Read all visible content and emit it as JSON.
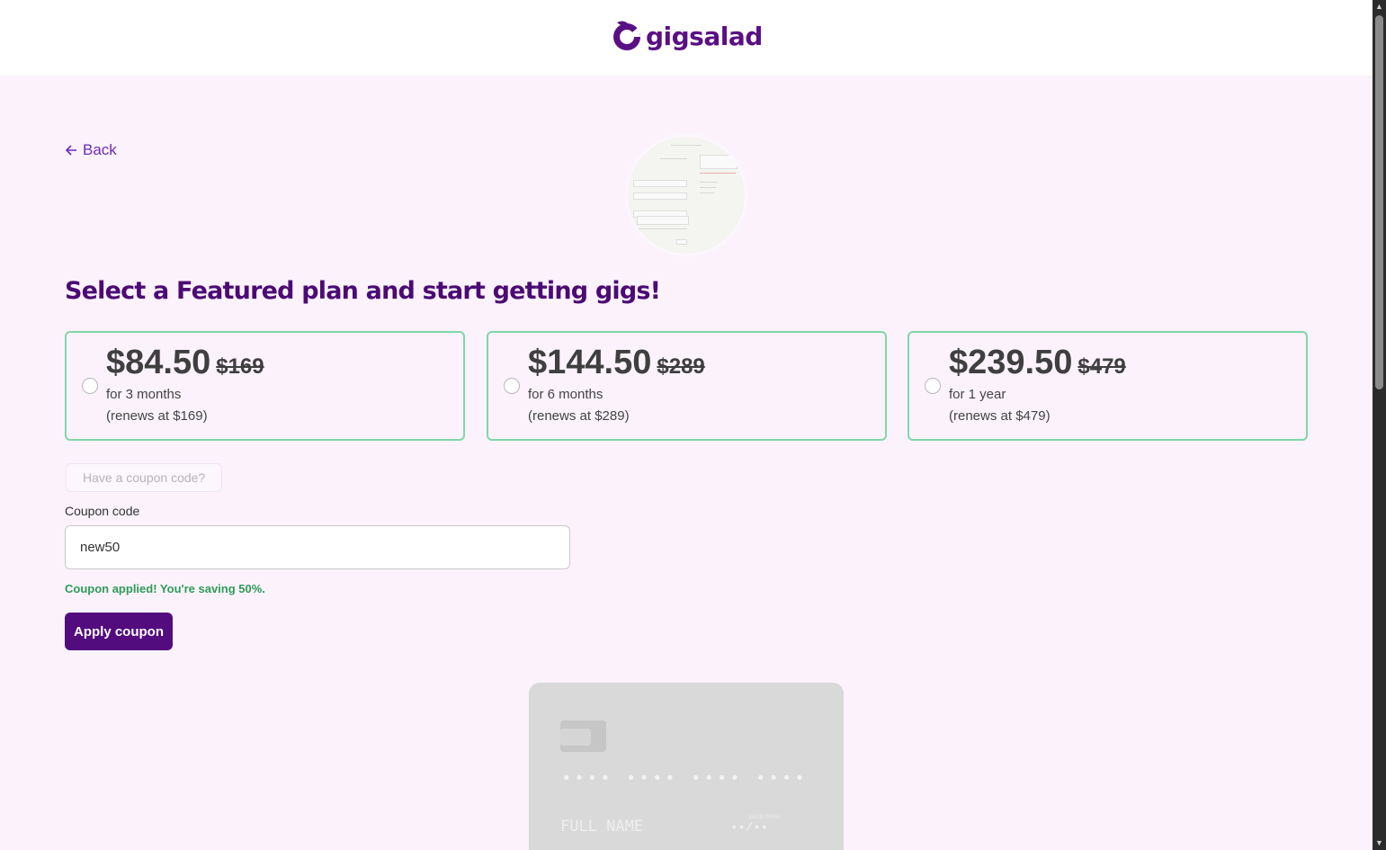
{
  "brand": {
    "name": "gigsalad",
    "color": "#530c7e"
  },
  "nav": {
    "back_label": "Back"
  },
  "headline": "Select a Featured plan and start getting gigs!",
  "plans": [
    {
      "price": "$84.50",
      "original": "$169",
      "term": "for 3 months",
      "renews": "(renews at $169)"
    },
    {
      "price": "$144.50",
      "original": "$289",
      "term": "for 6 months",
      "renews": "(renews at $289)"
    },
    {
      "price": "$239.50",
      "original": "$479",
      "term": "for 1 year",
      "renews": "(renews at $479)"
    }
  ],
  "coupon": {
    "toggle_label": "Have a coupon code?",
    "field_label": "Coupon code",
    "value": "new50",
    "success_message": "Coupon applied! You're saving 50%.",
    "apply_label": "Apply coupon"
  },
  "card_preview": {
    "number": "•••• •••• •••• ••••",
    "name": "FULL NAME",
    "expiry_label": "VALID THRU",
    "expiry": "••/••"
  },
  "colors": {
    "accent": "#530c7e",
    "success": "#2e9b57",
    "plan_border": "#7fd7a8",
    "page_bg": "#fbf2fc"
  }
}
